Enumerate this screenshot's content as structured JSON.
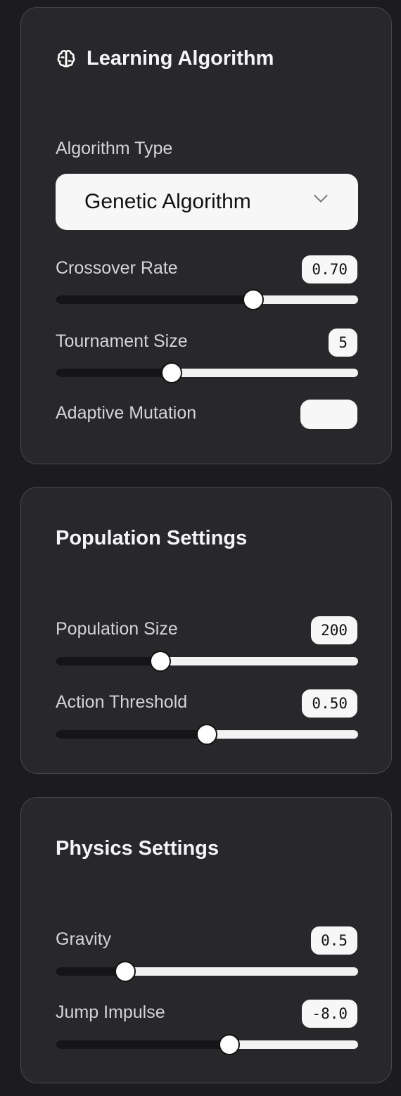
{
  "learning": {
    "title": "Learning Algorithm",
    "icon": "brain-icon",
    "algorithm_label": "Algorithm Type",
    "algorithm_value": "Genetic Algorithm",
    "crossover": {
      "label": "Crossover Rate",
      "value": "0.70",
      "fraction": 0.665
    },
    "tournament": {
      "label": "Tournament Size",
      "value": "5",
      "fraction": 0.375
    },
    "adaptive": {
      "label": "Adaptive Mutation",
      "on": false
    }
  },
  "population": {
    "title": "Population Settings",
    "size": {
      "label": "Population Size",
      "value": "200",
      "fraction": 0.335
    },
    "threshold": {
      "label": "Action Threshold",
      "value": "0.50",
      "fraction": 0.5
    }
  },
  "physics": {
    "title": "Physics Settings",
    "gravity": {
      "label": "Gravity",
      "value": "0.5",
      "fraction": 0.21
    },
    "jump": {
      "label": "Jump Impulse",
      "value": "-8.0",
      "fraction": 0.58
    }
  }
}
